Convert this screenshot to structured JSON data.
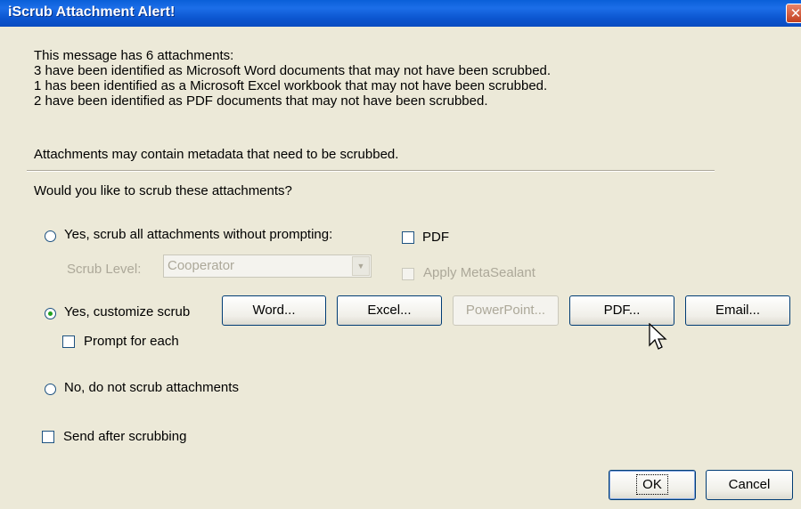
{
  "window": {
    "title": "iScrub Attachment Alert!",
    "close_glyph": "✕"
  },
  "message": {
    "lines": [
      "This message has 6 attachments:",
      "3 have been identified as Microsoft Word documents that may not have been scrubbed.",
      "1 has been identified as a Microsoft Excel workbook that may not have been scrubbed.",
      "2 have been identified as PDF documents that may not have been scrubbed."
    ],
    "warning": "Attachments may contain metadata that need to be scrubbed.",
    "question": "Would you like to scrub these attachments?"
  },
  "options": {
    "scrub_all": {
      "label": "Yes, scrub all attachments without prompting:",
      "checked": false
    },
    "pdf_check": {
      "label": "PDF",
      "checked": false
    },
    "scrub_level": {
      "label": "Scrub Level:",
      "value": "Cooperator",
      "disabled": true
    },
    "apply_metasealant": {
      "label": "Apply MetaSealant",
      "checked": false,
      "disabled": true
    },
    "customize": {
      "label": "Yes, customize scrub",
      "checked": true
    },
    "prompt_each": {
      "label": "Prompt for each",
      "checked": false
    },
    "no_scrub": {
      "label": "No, do not scrub attachments",
      "checked": false
    },
    "send_after": {
      "label": "Send after scrubbing",
      "checked": false
    }
  },
  "customize_buttons": [
    {
      "label": "Word...",
      "disabled": false
    },
    {
      "label": "Excel...",
      "disabled": false
    },
    {
      "label": "PowerPoint...",
      "disabled": true
    },
    {
      "label": "PDF...",
      "disabled": false
    },
    {
      "label": "Email...",
      "disabled": false
    }
  ],
  "footer": {
    "ok_label": "OK",
    "cancel_label": "Cancel"
  }
}
